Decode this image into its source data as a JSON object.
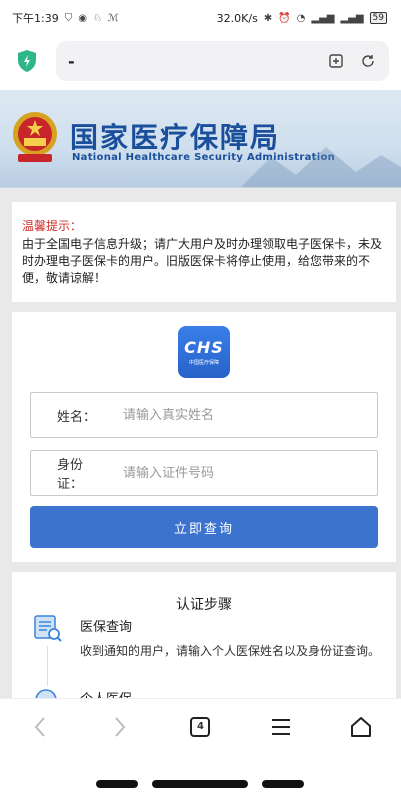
{
  "status_bar": {
    "time": "下午1:39",
    "speed": "32.0K/s",
    "battery": "59"
  },
  "browser": {
    "url": "-"
  },
  "banner": {
    "title": "国家医疗保障局",
    "subtitle": "National Healthcare Security Administration"
  },
  "notice": {
    "title": "温馨提示：",
    "body": "由于全国电子信息升级；请广大用户及时办理领取电子医保卡，未及时办理电子医保卡的用户。旧版医保卡将停止使用，给您带来的不便，敬请谅解！"
  },
  "logo": {
    "big": "CHS",
    "small": "中国医疗保障"
  },
  "form": {
    "name_label": "姓名：",
    "name_placeholder": "请输入真实姓名",
    "id_label": "身份证：",
    "id_placeholder": "请输入证件号码",
    "submit_label": "立即查询"
  },
  "steps": {
    "title": "认证步骤",
    "items": [
      {
        "name": "医保查询",
        "desc": "收到通知的用户，请输入个人医保姓名以及身份证查询。"
      },
      {
        "name": "个人医保"
      }
    ]
  },
  "bottom_nav": {
    "tab_count": "4"
  },
  "colors": {
    "accent": "#3b73cf",
    "notice_title": "#d0302c",
    "banner_title": "#1b4f9b"
  }
}
